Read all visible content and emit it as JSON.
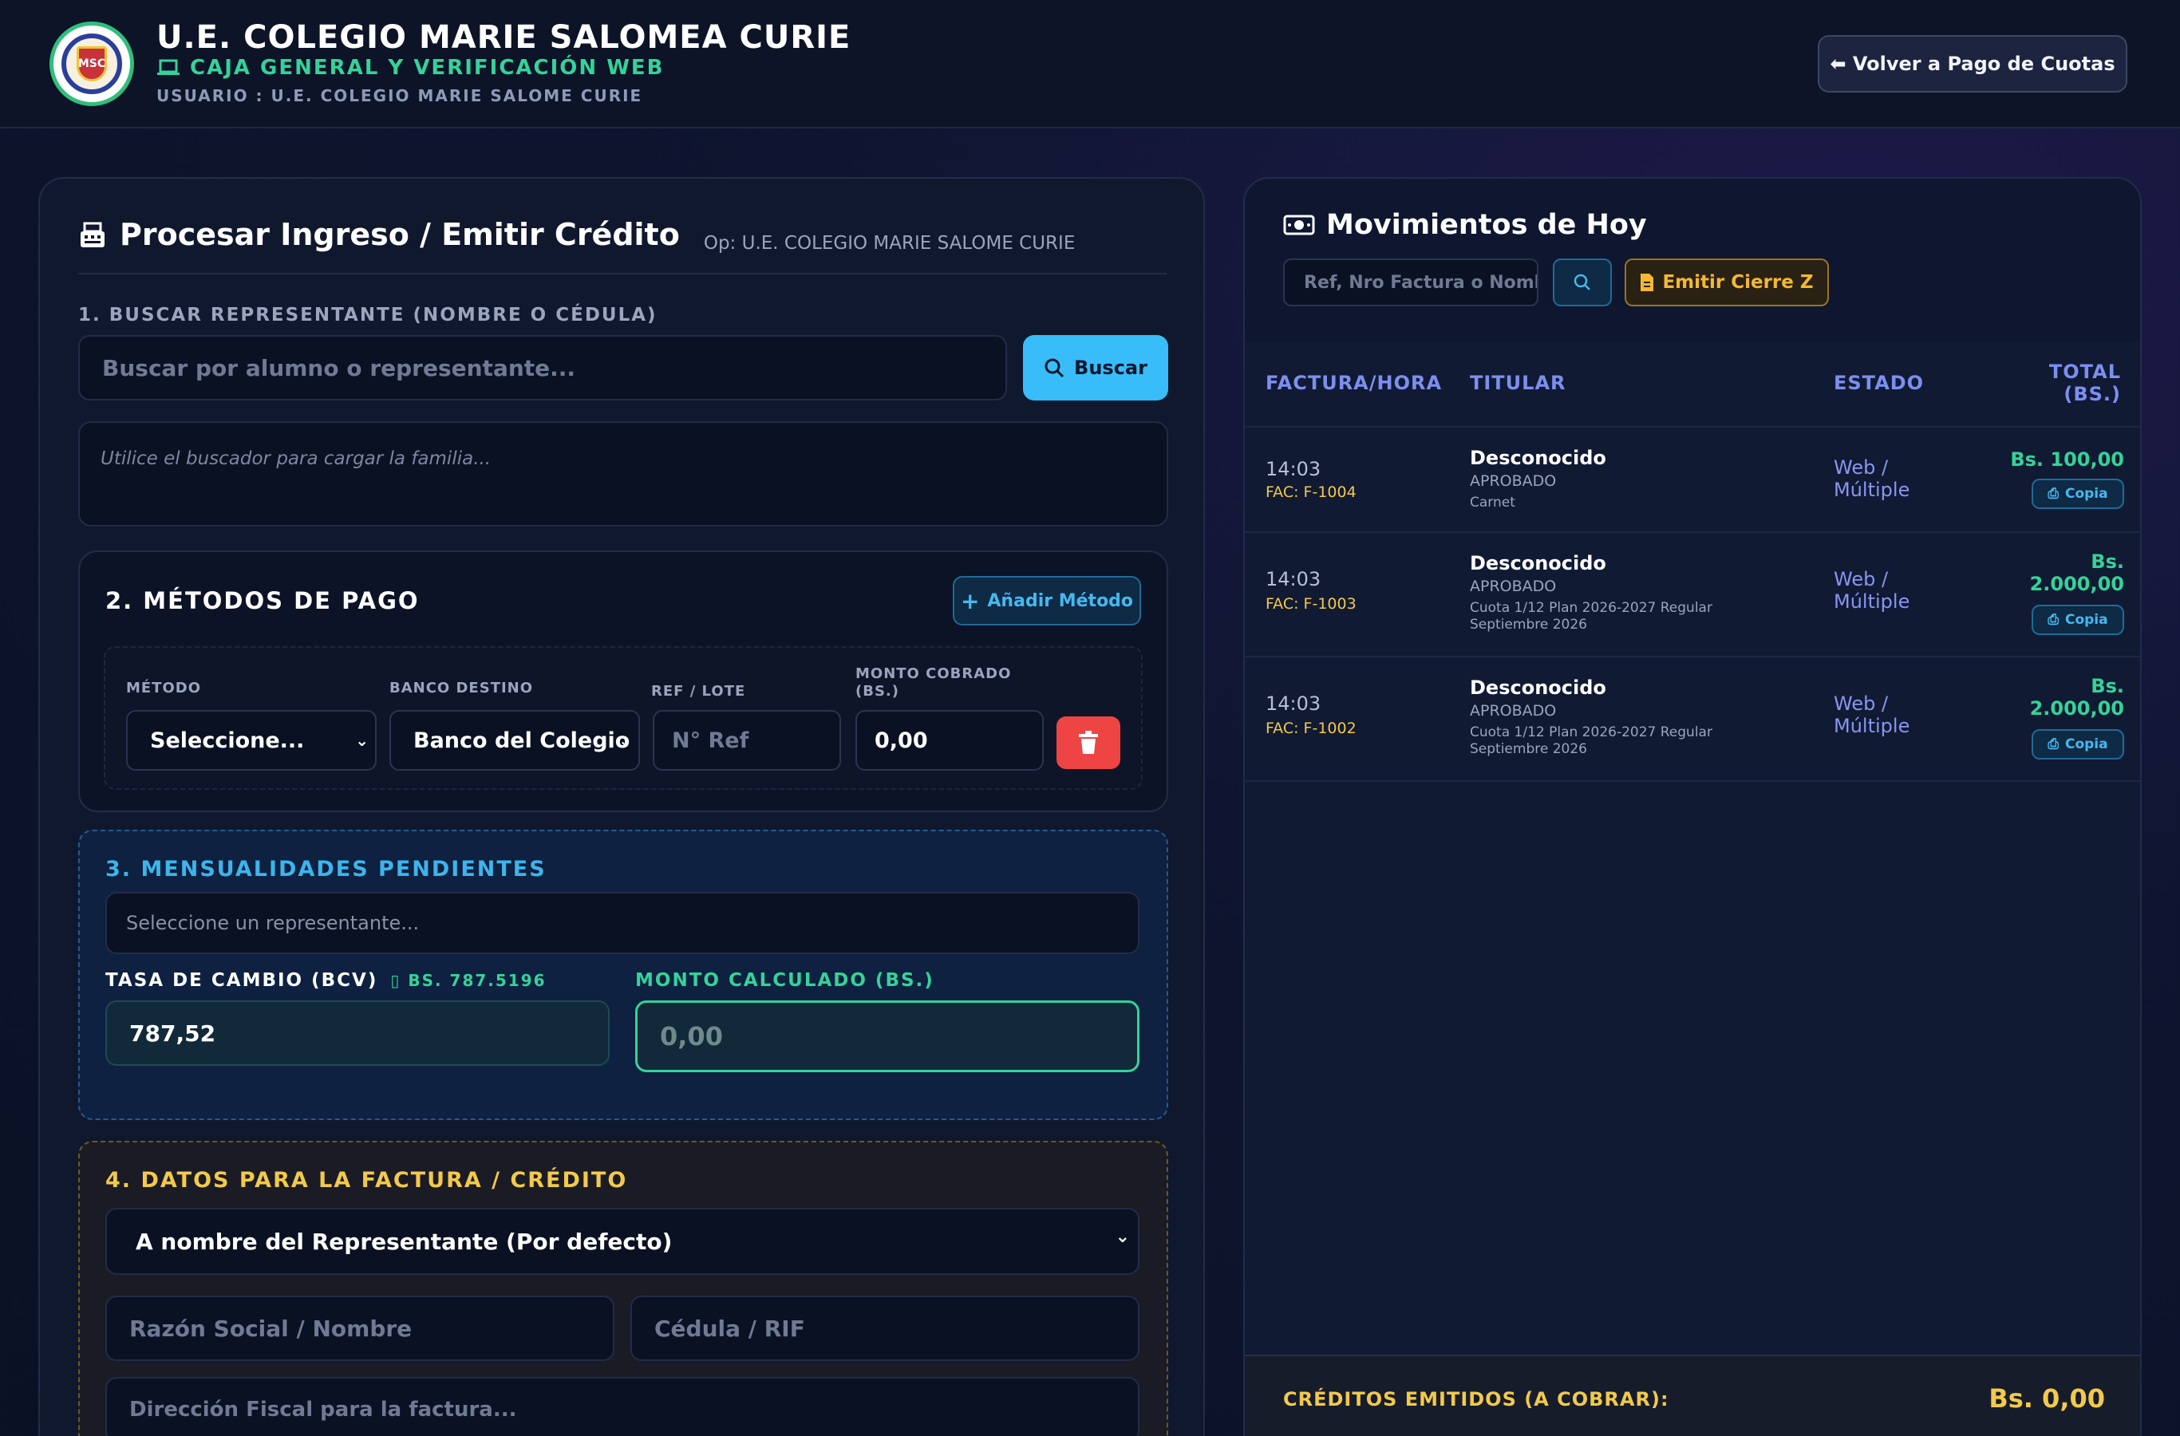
{
  "header": {
    "title": "U.E. COLEGIO MARIE SALOMEA CURIE",
    "subtitle": "CAJA GENERAL Y VERIFICACIÓN WEB",
    "user": "USUARIO : U.E. COLEGIO MARIE SALOME CURIE",
    "back_button": "⬅ Volver a Pago de Cuotas",
    "logo_text": "MSC"
  },
  "left": {
    "title": "Procesar Ingreso / Emitir Crédito",
    "operator": "Op: U.E. COLEGIO MARIE SALOME CURIE",
    "section1_label": "1. BUSCAR REPRESENTANTE (NOMBRE O CÉDULA)",
    "search_placeholder": "Buscar por alumno o representante...",
    "search_button": "Buscar",
    "family_hint": "Utilice el buscador para cargar la familia...",
    "section2_title": "2. MÉTODOS DE PAGO",
    "add_method_button": "Añadir Método",
    "method_label": "MÉTODO",
    "bank_label": "BANCO DESTINO",
    "ref_label": "REF / LOTE",
    "amount_label_1": "MONTO COBRADO",
    "amount_label_2": "(BS.)",
    "method_value": "Seleccione...",
    "bank_value": "Banco del Colegio",
    "ref_placeholder": "N° Ref",
    "amount_value": "0,00",
    "section3_title": "3. MENSUALIDADES PENDIENTES",
    "pending_placeholder": "Seleccione un representante...",
    "rate_label": "TASA DE CAMBIO (BCV)",
    "rate_badge": "BS. 787.5196",
    "rate_value": "787,52",
    "calc_label": "MONTO CALCULADO (BS.)",
    "calc_value": "0,00",
    "section4_title": "4. DATOS PARA LA FACTURA / CRÉDITO",
    "invoice_select": "A nombre del Representante (Por defecto)",
    "razon_placeholder": "Razón Social / Nombre",
    "cedula_placeholder": "Cédula / RIF",
    "direccion_placeholder": "Dirección Fiscal para la factura..."
  },
  "right": {
    "title": "Movimientos de Hoy",
    "search_placeholder": "Ref, Nro Factura o Nombre",
    "cierre_button": "Emitir Cierre Z",
    "col_factura": "FACTURA/HORA",
    "col_titular": "TITULAR",
    "col_estado": "ESTADO",
    "col_total_1": "TOTAL",
    "col_total_2": "(BS.)",
    "rows": [
      {
        "time": "14:03",
        "fac": "FAC: F-1004",
        "name": "Desconocido",
        "status": "APROBADO",
        "desc": "Carnet",
        "estado_1": "Web /",
        "estado_2": "Múltiple",
        "amount_1": "Bs. 100,00",
        "amount_2": "",
        "copia": "Copia"
      },
      {
        "time": "14:03",
        "fac": "FAC: F-1003",
        "name": "Desconocido",
        "status": "APROBADO",
        "desc": "Cuota 1/12 Plan 2026-2027 Regular Septiembre 2026",
        "estado_1": "Web /",
        "estado_2": "Múltiple",
        "amount_1": "Bs.",
        "amount_2": "2.000,00",
        "copia": "Copia"
      },
      {
        "time": "14:03",
        "fac": "FAC: F-1002",
        "name": "Desconocido",
        "status": "APROBADO",
        "desc": "Cuota 1/12 Plan 2026-2027 Regular Septiembre 2026",
        "estado_1": "Web /",
        "estado_2": "Múltiple",
        "amount_1": "Bs.",
        "amount_2": "2.000,00",
        "copia": "Copia"
      }
    ],
    "footer_label": "CRÉDITOS EMITIDOS (A COBRAR):",
    "footer_amount": "Bs. 0,00"
  },
  "colors": {
    "accent_green": "#34d399",
    "accent_blue": "#38bdf8",
    "accent_gold": "#f2c94c",
    "danger": "#ef4444"
  }
}
